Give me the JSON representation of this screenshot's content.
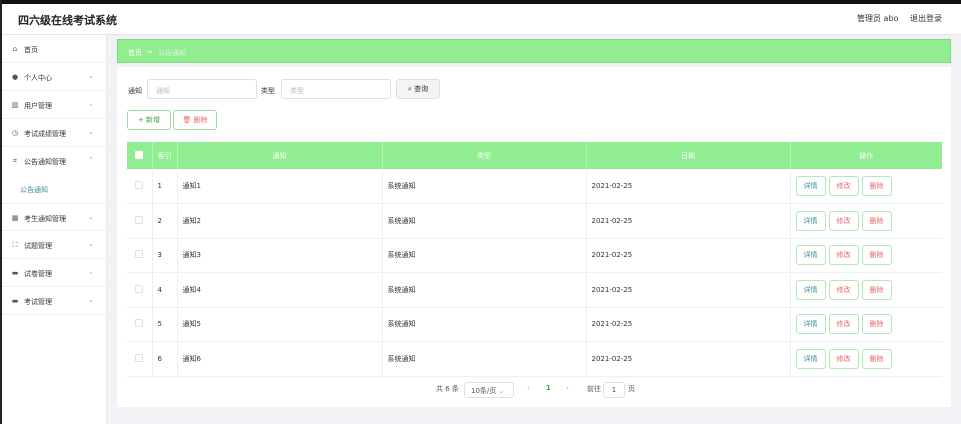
{
  "header": {
    "title": "四六级在线考试系统",
    "admin": "管理员 abo",
    "logout": "退出登录"
  },
  "sidebar": {
    "items": [
      {
        "label": "首页",
        "icon": "home-icon",
        "glyph": "⌂",
        "chev": ""
      },
      {
        "label": "个人中心",
        "icon": "user-icon",
        "glyph": "●",
        "chev": "⌄"
      },
      {
        "label": "用户管理",
        "icon": "chart-icon",
        "glyph": "▥",
        "chev": "⌄"
      },
      {
        "label": "考试成绩管理",
        "icon": "clock-icon",
        "glyph": "◷",
        "chev": "⌄"
      },
      {
        "label": "公告通知管理",
        "icon": "crop-icon",
        "glyph": "⌗",
        "chev": "⌃"
      },
      {
        "label": "考生通知管理",
        "icon": "grid-icon",
        "glyph": "▦",
        "chev": "⌄"
      },
      {
        "label": "试题管理",
        "icon": "fullscreen-icon",
        "glyph": "⛶",
        "chev": "⌄"
      },
      {
        "label": "试卷管理",
        "icon": "monitor-icon",
        "glyph": "▬",
        "chev": "⌄"
      },
      {
        "label": "考试管理",
        "icon": "monitor-icon",
        "glyph": "▬",
        "chev": "⌄"
      }
    ],
    "sub_item": "公告通知"
  },
  "breadcrumb": {
    "home": "首页",
    "arrow": "→",
    "current": "公告通知"
  },
  "search": {
    "notice_label": "通知",
    "notice_placeholder": "通知",
    "type_label": "类型",
    "type_placeholder": "类型",
    "query_button": "查询"
  },
  "actions": {
    "add": "新增",
    "delete": "删除"
  },
  "table": {
    "headers": [
      "索引",
      "通知",
      "类型",
      "日期",
      "操作"
    ],
    "rows": [
      {
        "index": "1",
        "notice": "通知1",
        "type": "系统通知",
        "date": "2021-02-25"
      },
      {
        "index": "2",
        "notice": "通知2",
        "type": "系统通知",
        "date": "2021-02-25"
      },
      {
        "index": "3",
        "notice": "通知3",
        "type": "系统通知",
        "date": "2021-02-25"
      },
      {
        "index": "4",
        "notice": "通知4",
        "type": "系统通知",
        "date": "2021-02-25"
      },
      {
        "index": "5",
        "notice": "通知5",
        "type": "系统通知",
        "date": "2021-02-25"
      },
      {
        "index": "6",
        "notice": "通知6",
        "type": "系统通知",
        "date": "2021-02-25"
      }
    ],
    "row_actions": {
      "detail": "详情",
      "edit": "修改",
      "delete": "删除"
    }
  },
  "pagination": {
    "total": "共 6 条",
    "page_size": "10条/页",
    "prev": "‹",
    "current": "1",
    "next": "›",
    "goto": "前往",
    "page_input": "1",
    "page_suffix": "页"
  },
  "colors": {
    "accent": "#90ee90",
    "danger": "#e66666",
    "info": "#3a8e9e"
  }
}
